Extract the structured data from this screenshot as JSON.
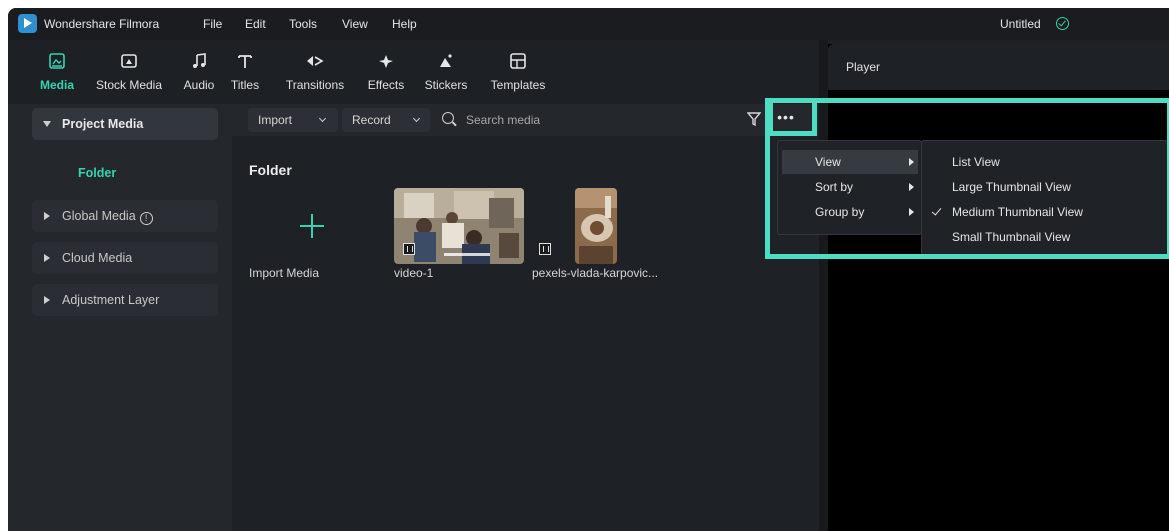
{
  "app": {
    "name": "Wondershare Filmora",
    "document_title": "Untitled"
  },
  "menu": [
    "File",
    "Edit",
    "Tools",
    "View",
    "Help"
  ],
  "tabs": [
    {
      "label": "Media",
      "icon": "media-icon",
      "active": true
    },
    {
      "label": "Stock Media",
      "icon": "stock-media-icon"
    },
    {
      "label": "Audio",
      "icon": "music-note-icon"
    },
    {
      "label": "Titles",
      "icon": "text-icon"
    },
    {
      "label": "Transitions",
      "icon": "transition-arrows-icon"
    },
    {
      "label": "Effects",
      "icon": "sparkle-icon"
    },
    {
      "label": "Stickers",
      "icon": "sticker-icon"
    },
    {
      "label": "Templates",
      "icon": "template-grid-icon"
    }
  ],
  "sidebar": {
    "project_media": "Project Media",
    "folder": "Folder",
    "global_media": "Global Media",
    "cloud_media": "Cloud Media",
    "adjustment_layer": "Adjustment Layer"
  },
  "media_toolbar": {
    "import": "Import",
    "record": "Record",
    "search_placeholder": "Search media"
  },
  "content": {
    "section_title": "Folder",
    "items": [
      {
        "label": "Import Media"
      },
      {
        "label": "video-1"
      },
      {
        "label": "pexels-vlada-karpovic..."
      }
    ]
  },
  "player": {
    "title": "Player"
  },
  "context_menu": {
    "items": [
      {
        "label": "View",
        "has_submenu": true,
        "highlighted": true
      },
      {
        "label": "Sort by",
        "has_submenu": true
      },
      {
        "label": "Group by",
        "has_submenu": true
      }
    ],
    "view_submenu": [
      {
        "label": "List View",
        "checked": false
      },
      {
        "label": "Large Thumbnail View",
        "checked": false
      },
      {
        "label": "Medium Thumbnail View",
        "checked": true
      },
      {
        "label": "Small Thumbnail View",
        "checked": false
      }
    ]
  },
  "colors": {
    "accent": "#35d4b0",
    "highlight_box": "#4fdcc0",
    "background": "#1d2025"
  }
}
